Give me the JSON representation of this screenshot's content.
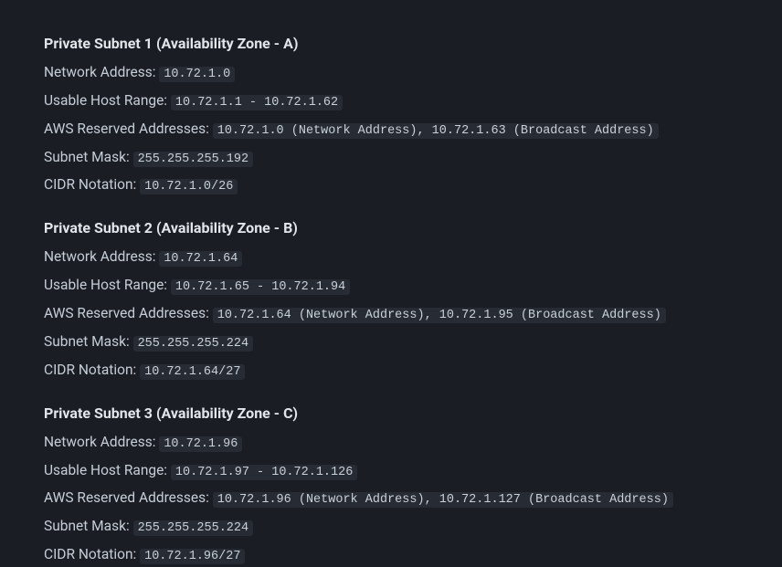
{
  "subnets": [
    {
      "title": "Private Subnet 1 (Availability Zone - A)",
      "labels": {
        "network_address": "Network Address: ",
        "host_range": "Usable Host Range: ",
        "reserved": "AWS Reserved Addresses: ",
        "mask": "Subnet Mask: ",
        "cidr": "CIDR Notation: "
      },
      "values": {
        "network_address": "10.72.1.0",
        "host_range": "10.72.1.1 - 10.72.1.62",
        "reserved": "10.72.1.0 (Network Address), 10.72.1.63 (Broadcast Address)",
        "mask": "255.255.255.192",
        "cidr": "10.72.1.0/26"
      }
    },
    {
      "title": "Private Subnet 2 (Availability Zone - B)",
      "labels": {
        "network_address": "Network Address: ",
        "host_range": "Usable Host Range: ",
        "reserved": "AWS Reserved Addresses: ",
        "mask": "Subnet Mask: ",
        "cidr": "CIDR Notation: "
      },
      "values": {
        "network_address": "10.72.1.64",
        "host_range": "10.72.1.65 - 10.72.1.94",
        "reserved": "10.72.1.64 (Network Address), 10.72.1.95 (Broadcast Address)",
        "mask": "255.255.255.224",
        "cidr": "10.72.1.64/27"
      }
    },
    {
      "title": "Private Subnet 3 (Availability Zone - C)",
      "labels": {
        "network_address": "Network Address: ",
        "host_range": "Usable Host Range: ",
        "reserved": "AWS Reserved Addresses: ",
        "mask": "Subnet Mask: ",
        "cidr": "CIDR Notation: "
      },
      "values": {
        "network_address": "10.72.1.96",
        "host_range": "10.72.1.97 - 10.72.1.126",
        "reserved": "10.72.1.96 (Network Address), 10.72.1.127 (Broadcast Address)",
        "mask": "255.255.255.224",
        "cidr": "10.72.1.96/27"
      }
    }
  ]
}
